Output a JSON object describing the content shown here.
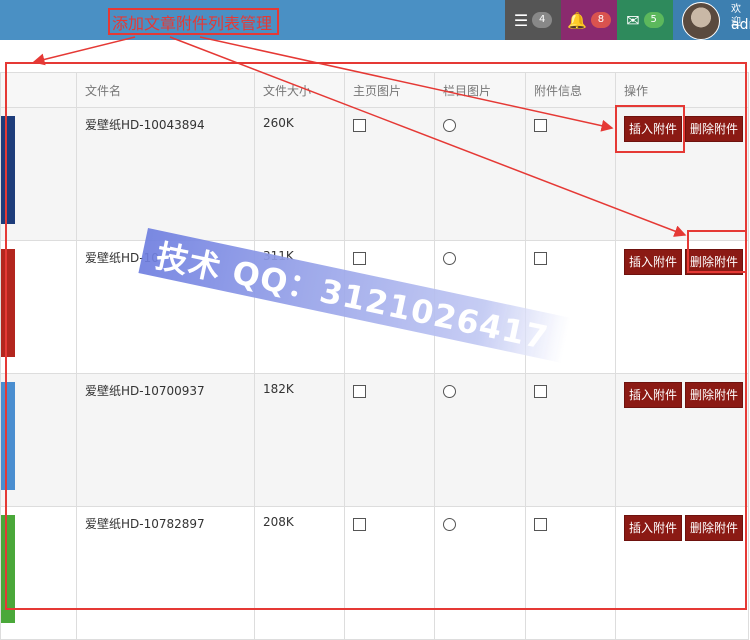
{
  "topbar": {
    "tasks_badge": "4",
    "notifications_badge": "8",
    "messages_badge": "5",
    "welcome_text": "欢迎",
    "username": "adn"
  },
  "annotation": {
    "title": "添加文章附件列表管理"
  },
  "watermark": "技术 QQ：3121026417",
  "table": {
    "columns": [
      "",
      "文件名",
      "文件大小",
      "主页图片",
      "栏目图片",
      "附件信息",
      "操作"
    ],
    "rows": [
      {
        "filename": "爱壁纸HD-10043894",
        "size": "260K",
        "thumb_color": "#1d3c7a"
      },
      {
        "filename": "爱壁纸HD-10",
        "size": "311K",
        "thumb_color": "#b3261e"
      },
      {
        "filename": "爱壁纸HD-10700937",
        "size": "182K",
        "thumb_color": "#4a8ed0"
      },
      {
        "filename": "爱壁纸HD-10782897",
        "size": "208K",
        "thumb_color": "#4aa83a"
      }
    ],
    "insert_label": "插入附件",
    "delete_label": "删除附件"
  }
}
